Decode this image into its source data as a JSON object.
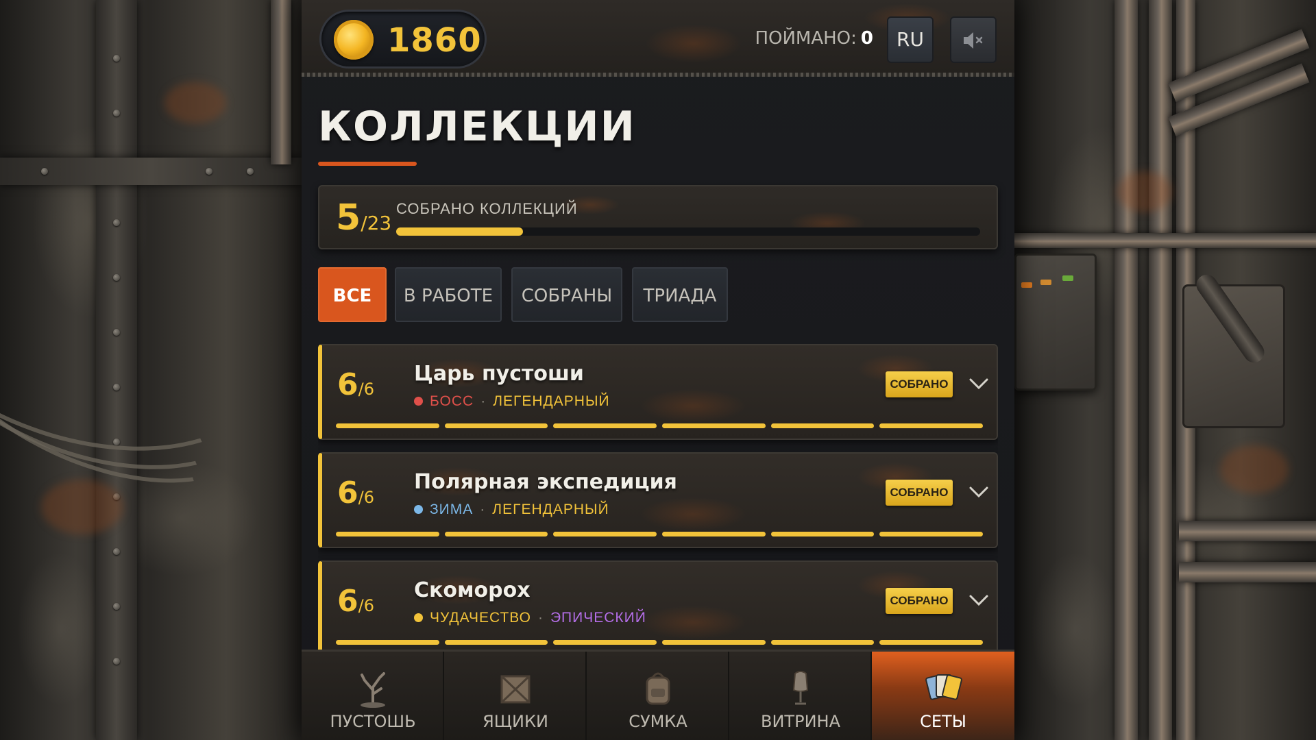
{
  "header": {
    "coins": "1860",
    "caught_label": "ПОЙМАНО:",
    "caught_value": "0",
    "language": "RU",
    "sound_icon": "muted-speaker-icon"
  },
  "page": {
    "title": "КОЛЛЕКЦИИ"
  },
  "summary": {
    "collected": "5",
    "total": "/23",
    "label": "СОБРАНО КОЛЛЕКЦИЙ",
    "progress_fraction": 0.217,
    "accent_color": "#f2c33a"
  },
  "filters": {
    "tabs": [
      {
        "label": "ВСЕ",
        "active": true
      },
      {
        "label": "В РАБОТЕ",
        "active": false
      },
      {
        "label": "СОБРАНЫ",
        "active": false
      },
      {
        "label": "ТРИАДА",
        "active": false
      }
    ],
    "active_color": "#d9561e"
  },
  "collections": [
    {
      "count": "6",
      "total": "/6",
      "name": "Царь пустоши",
      "category": "БОСС",
      "category_color": "#e0504a",
      "rarity": "ЛЕГЕНДАРНЫЙ",
      "rarity_color": "#f2c33a",
      "badge": "СОБРАНО",
      "segments_filled": 6
    },
    {
      "count": "6",
      "total": "/6",
      "name": "Полярная экспедиция",
      "category": "ЗИМА",
      "category_color": "#7cb8e8",
      "rarity": "ЛЕГЕНДАРНЫЙ",
      "rarity_color": "#f2c33a",
      "badge": "СОБРАНО",
      "segments_filled": 6
    },
    {
      "count": "6",
      "total": "/6",
      "name": "Скоморох",
      "category": "ЧУДАЧЕСТВО",
      "category_color": "#f2c33a",
      "rarity": "ЭПИЧЕСКИЙ",
      "rarity_color": "#b46ee8",
      "badge": "СОБРАНО",
      "segments_filled": 6
    }
  ],
  "nav": {
    "items": [
      {
        "label": "ПУСТОШЬ",
        "icon": "dead-tree-icon",
        "active": false
      },
      {
        "label": "ЯЩИКИ",
        "icon": "crate-icon",
        "active": false
      },
      {
        "label": "СУМКА",
        "icon": "backpack-icon",
        "active": false
      },
      {
        "label": "ВИТРИНА",
        "icon": "mannequin-icon",
        "active": false
      },
      {
        "label": "СЕТЫ",
        "icon": "cards-icon",
        "active": true
      }
    ]
  }
}
